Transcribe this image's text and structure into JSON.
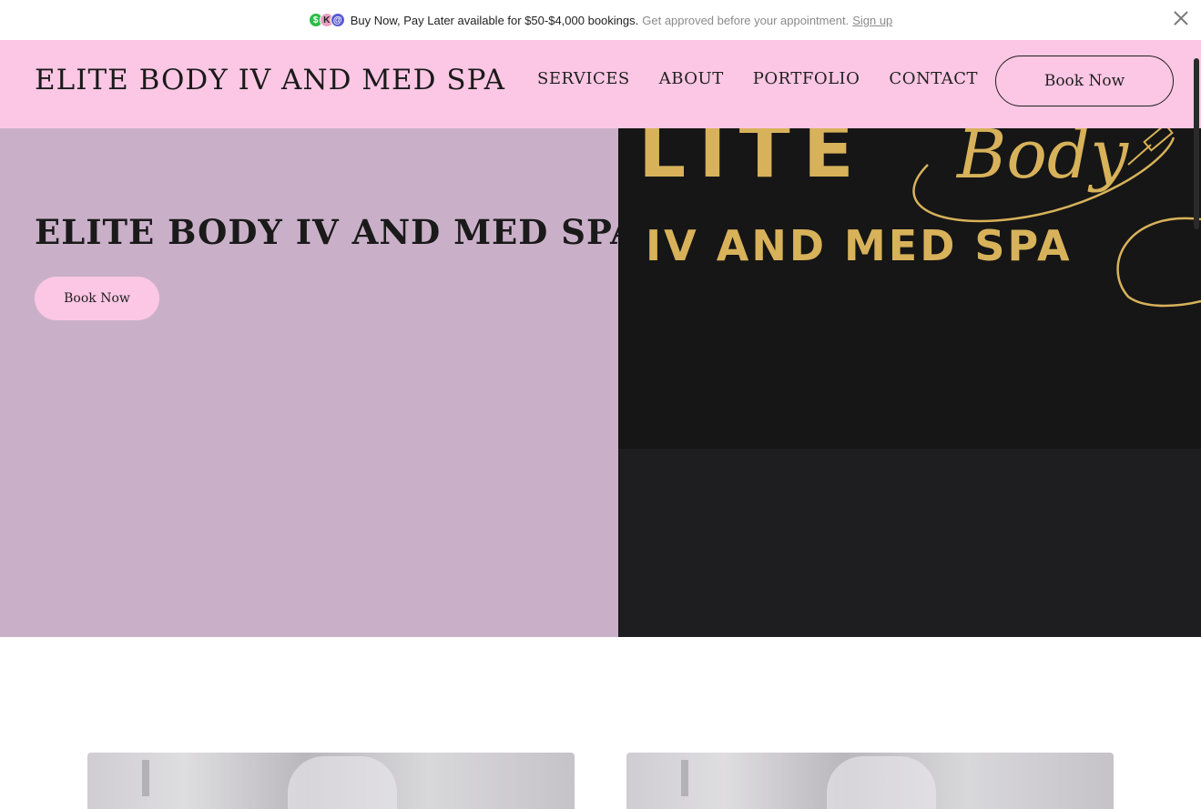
{
  "promo": {
    "main_text": "Buy Now, Pay Later available for $50-$4,000 bookings.",
    "sub_text": "Get approved before your appointment.",
    "link_text": "Sign up",
    "icons": [
      {
        "name": "cashapp-icon",
        "glyph": "$",
        "color": "#2dbb4a"
      },
      {
        "name": "klarna-icon",
        "glyph": "K",
        "color": "#e8a0c0"
      },
      {
        "name": "afterpay-icon",
        "glyph": "@",
        "color": "#5b5bd6"
      }
    ]
  },
  "header": {
    "brand": "ELITE BODY IV AND MED SPA",
    "nav": [
      "SERVICES",
      "ABOUT",
      "PORTFOLIO",
      "CONTACT"
    ],
    "book_label": "Book Now"
  },
  "hero": {
    "title": "ELITE BODY IV AND MED SPA",
    "book_label": "Book Now",
    "logo_line1": "LITE",
    "logo_script": "Body",
    "logo_line2": "IV AND MED SPA"
  },
  "colors": {
    "header_bg": "#fcc7e4",
    "hero_left_bg": "#c9b0c8",
    "hero_right_bg": "#1e1d1f",
    "gold": "#d8b25a"
  }
}
